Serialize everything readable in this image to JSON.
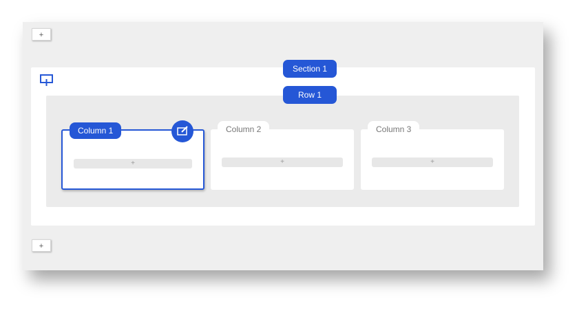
{
  "canvas": {
    "add_above_label": "+",
    "add_below_label": "+"
  },
  "section": {
    "label": "Section 1",
    "icon": "add-section-icon"
  },
  "row": {
    "label": "Row 1"
  },
  "columns": [
    {
      "label": "Column 1",
      "add_label": "+",
      "active": true,
      "edit_icon": "edit-icon"
    },
    {
      "label": "Column 2",
      "add_label": "+",
      "active": false
    },
    {
      "label": "Column 3",
      "add_label": "+",
      "active": false
    }
  ],
  "colors": {
    "accent": "#2557d6",
    "canvas_bg": "#efefef",
    "row_bg": "#ebebeb"
  }
}
